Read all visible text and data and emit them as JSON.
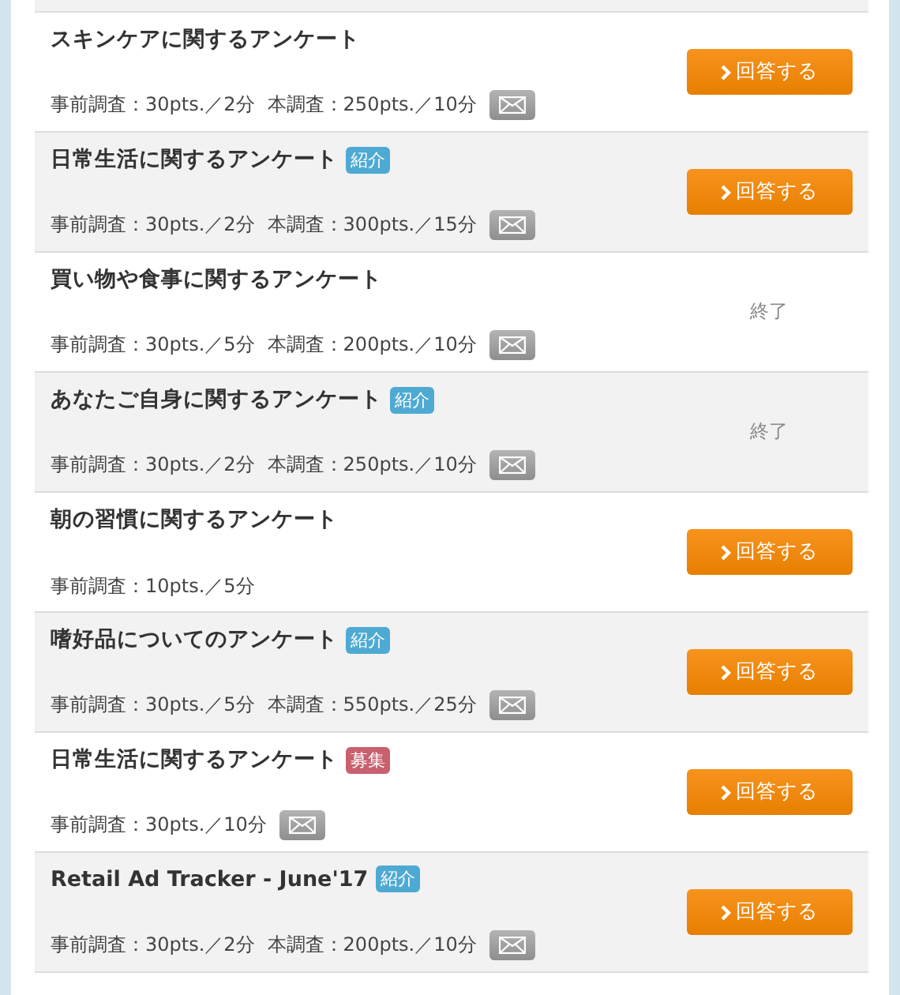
{
  "surveys": [
    {
      "title": "スキンケアに関するアンケート",
      "pre": "事前調査：30pts.／2分",
      "main": "本調査：250pts.／10分",
      "mail": true,
      "status": {
        "kind": "answer",
        "label": "回答する"
      }
    },
    {
      "title": "日常生活に関するアンケート",
      "tag": {
        "kind": "intro",
        "label": "紹介"
      },
      "pre": "事前調査：30pts.／2分",
      "main": "本調査：300pts.／15分",
      "mail": true,
      "status": {
        "kind": "answer",
        "label": "回答する"
      }
    },
    {
      "title": "買い物や食事に関するアンケート",
      "pre": "事前調査：30pts.／5分",
      "main": "本調査：200pts.／10分",
      "mail": true,
      "status": {
        "kind": "closed",
        "label": "終了"
      }
    },
    {
      "title": "あなたご自身に関するアンケート",
      "tag": {
        "kind": "intro",
        "label": "紹介"
      },
      "pre": "事前調査：30pts.／2分",
      "main": "本調査：250pts.／10分",
      "mail": true,
      "status": {
        "kind": "closed",
        "label": "終了"
      }
    },
    {
      "title": "朝の習慣に関するアンケート",
      "pre": "事前調査：10pts.／5分",
      "mail": false,
      "status": {
        "kind": "answer",
        "label": "回答する"
      }
    },
    {
      "title": "嗜好品についてのアンケート",
      "tag": {
        "kind": "intro",
        "label": "紹介"
      },
      "pre": "事前調査：30pts.／5分",
      "main": "本調査：550pts.／25分",
      "mail": true,
      "status": {
        "kind": "answer",
        "label": "回答する"
      }
    },
    {
      "title": "日常生活に関するアンケート",
      "tag": {
        "kind": "recruit",
        "label": "募集"
      },
      "pre": "事前調査：30pts.／10分",
      "mail": true,
      "status": {
        "kind": "answer",
        "label": "回答する"
      }
    },
    {
      "title": "Retail Ad Tracker - June'17",
      "tag": {
        "kind": "intro",
        "label": "紹介"
      },
      "pre": "事前調査：30pts.／2分",
      "main": "本調査：200pts.／10分",
      "mail": true,
      "status": {
        "kind": "answer",
        "label": "回答する"
      }
    }
  ]
}
